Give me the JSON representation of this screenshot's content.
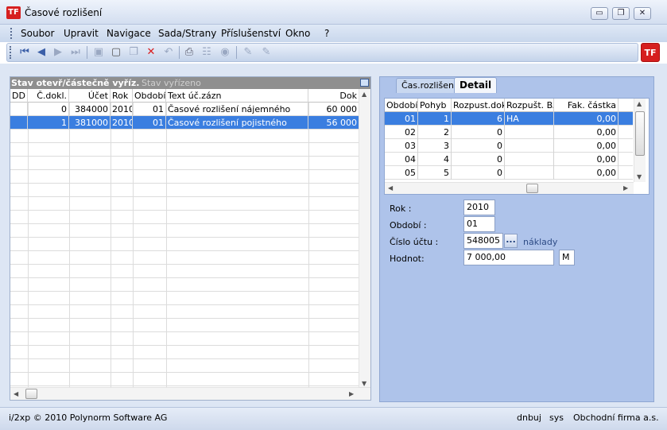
{
  "window": {
    "title": "Časové rozlišení",
    "app_icon": "TF",
    "controls": {
      "minimize": "▭",
      "restore": "❐",
      "close": "✕"
    }
  },
  "menu": [
    "Soubor",
    "Upravit",
    "Navigace",
    "Sada/Strany",
    "Příslušenství",
    "Okno",
    "?"
  ],
  "toolbar": {
    "icons": [
      "first-record-icon",
      "prev-record-icon",
      "next-record-icon",
      "last-record-icon",
      "save-icon",
      "new-document-icon",
      "copy-icon",
      "delete-icon",
      "undo-icon",
      "print-icon",
      "tree-icon",
      "settings-icon",
      "edit-icon",
      "edit-alt-icon"
    ],
    "logo": "TF"
  },
  "left_panel": {
    "filter_active": "Stav otevř/částečně vyříz.",
    "filter_inactive": "Stav vyřízeno",
    "columns": [
      "DD",
      "Č.dokl.",
      "Účet",
      "Rok",
      "Období",
      "Text úč.zázn",
      "Dok"
    ],
    "rows": [
      {
        "dd": "",
        "cdokl": "0",
        "ucet": "384000",
        "rok": "2010",
        "obdobi": "01",
        "text": "Časové rozlišení nájemného",
        "dok": "60 000"
      },
      {
        "dd": "",
        "cdokl": "1",
        "ucet": "381000",
        "rok": "2010",
        "obdobi": "01",
        "text": "Časové rozlišení pojistného",
        "dok": "56 000"
      }
    ]
  },
  "right_panel": {
    "tabs": [
      "Čas.rozlišení",
      "Detail"
    ],
    "active_tab": "Detail",
    "sub_columns": [
      "Období",
      "Pohyb",
      "Rozpust.dokl",
      "Rozpušt. BA",
      "Fak. částka"
    ],
    "sub_rows": [
      {
        "obdobi": "01",
        "pohyb": "1",
        "rozpust": "6",
        "ba": "HA",
        "fak": "0,00"
      },
      {
        "obdobi": "02",
        "pohyb": "2",
        "rozpust": "0",
        "ba": "",
        "fak": "0,00"
      },
      {
        "obdobi": "03",
        "pohyb": "3",
        "rozpust": "0",
        "ba": "",
        "fak": "0,00"
      },
      {
        "obdobi": "04",
        "pohyb": "4",
        "rozpust": "0",
        "ba": "",
        "fak": "0,00"
      },
      {
        "obdobi": "05",
        "pohyb": "5",
        "rozpust": "0",
        "ba": "",
        "fak": "0,00"
      }
    ],
    "form": {
      "rok_label": "Rok :",
      "rok_value": "2010",
      "obdobi_label": "Období :",
      "obdobi_value": "01",
      "ucet_label": "Číslo účtu :",
      "ucet_value": "548005",
      "ucet_button": "...",
      "ucet_hint": "náklady",
      "hodnot_label": "Hodnot:",
      "hodnot_value": "7 000,00",
      "currency": "M"
    }
  },
  "status": {
    "copyright": "i/2xp © 2010 Polynorm Software AG",
    "user": "dnbuj",
    "system": "sys",
    "company": "Obchodní firma a.s."
  },
  "colors": {
    "selection": "#3a7ee0",
    "accent_red": "#d61f1f",
    "panel_blue": "#aec3ea"
  }
}
